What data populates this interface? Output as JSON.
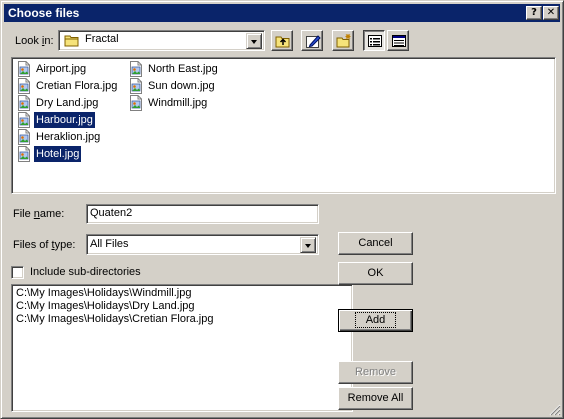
{
  "window": {
    "title": "Choose files",
    "help_glyph": "?",
    "close_glyph": "✕"
  },
  "look_in": {
    "label_pre": "Look ",
    "label_ul": "i",
    "label_post": "n:",
    "value": "Fractal",
    "icon": "folder-icon"
  },
  "toolbar": {
    "buttons": [
      {
        "name": "up-folder-button",
        "icon": "up-folder-icon"
      },
      {
        "name": "edit-button",
        "icon": "edit-icon"
      },
      {
        "name": "new-folder-button",
        "icon": "new-folder-icon"
      },
      {
        "name": "list-view-button",
        "icon": "list-view-icon",
        "pressed": true
      },
      {
        "name": "details-view-button",
        "icon": "details-view-icon"
      }
    ]
  },
  "files": [
    {
      "name": "Airport.jpg",
      "selected": false
    },
    {
      "name": "Cretian Flora.jpg",
      "selected": false
    },
    {
      "name": "Dry Land.jpg",
      "selected": false
    },
    {
      "name": "Harbour.jpg",
      "selected": true
    },
    {
      "name": "Heraklion.jpg",
      "selected": false
    },
    {
      "name": "Hotel.jpg",
      "selected": true
    },
    {
      "name": "North East.jpg",
      "selected": false
    },
    {
      "name": "Sun down.jpg",
      "selected": false
    },
    {
      "name": "Windmill.jpg",
      "selected": false
    }
  ],
  "file_name": {
    "label_pre": "File ",
    "label_ul": "n",
    "label_post": "ame:",
    "value": "Quaten2"
  },
  "file_type": {
    "label_pre": "Files of ",
    "label_ul": "t",
    "label_post": "ype:",
    "value": "All Files"
  },
  "include_subdirs": {
    "label": "Include sub-directories",
    "checked": false
  },
  "selected_paths": [
    "C:\\My Images\\Holidays\\Windmill.jpg",
    "C:\\My Images\\Holidays\\Dry Land.jpg",
    "C:\\My Images\\Holidays\\Cretian Flora.jpg"
  ],
  "buttons": {
    "cancel": "Cancel",
    "ok": "OK",
    "add": "Add",
    "remove": "Remove",
    "remove_all": "Remove All"
  },
  "colors": {
    "title_bar": "#0a246a",
    "face": "#d4d0c8",
    "selection": "#0a246a"
  }
}
